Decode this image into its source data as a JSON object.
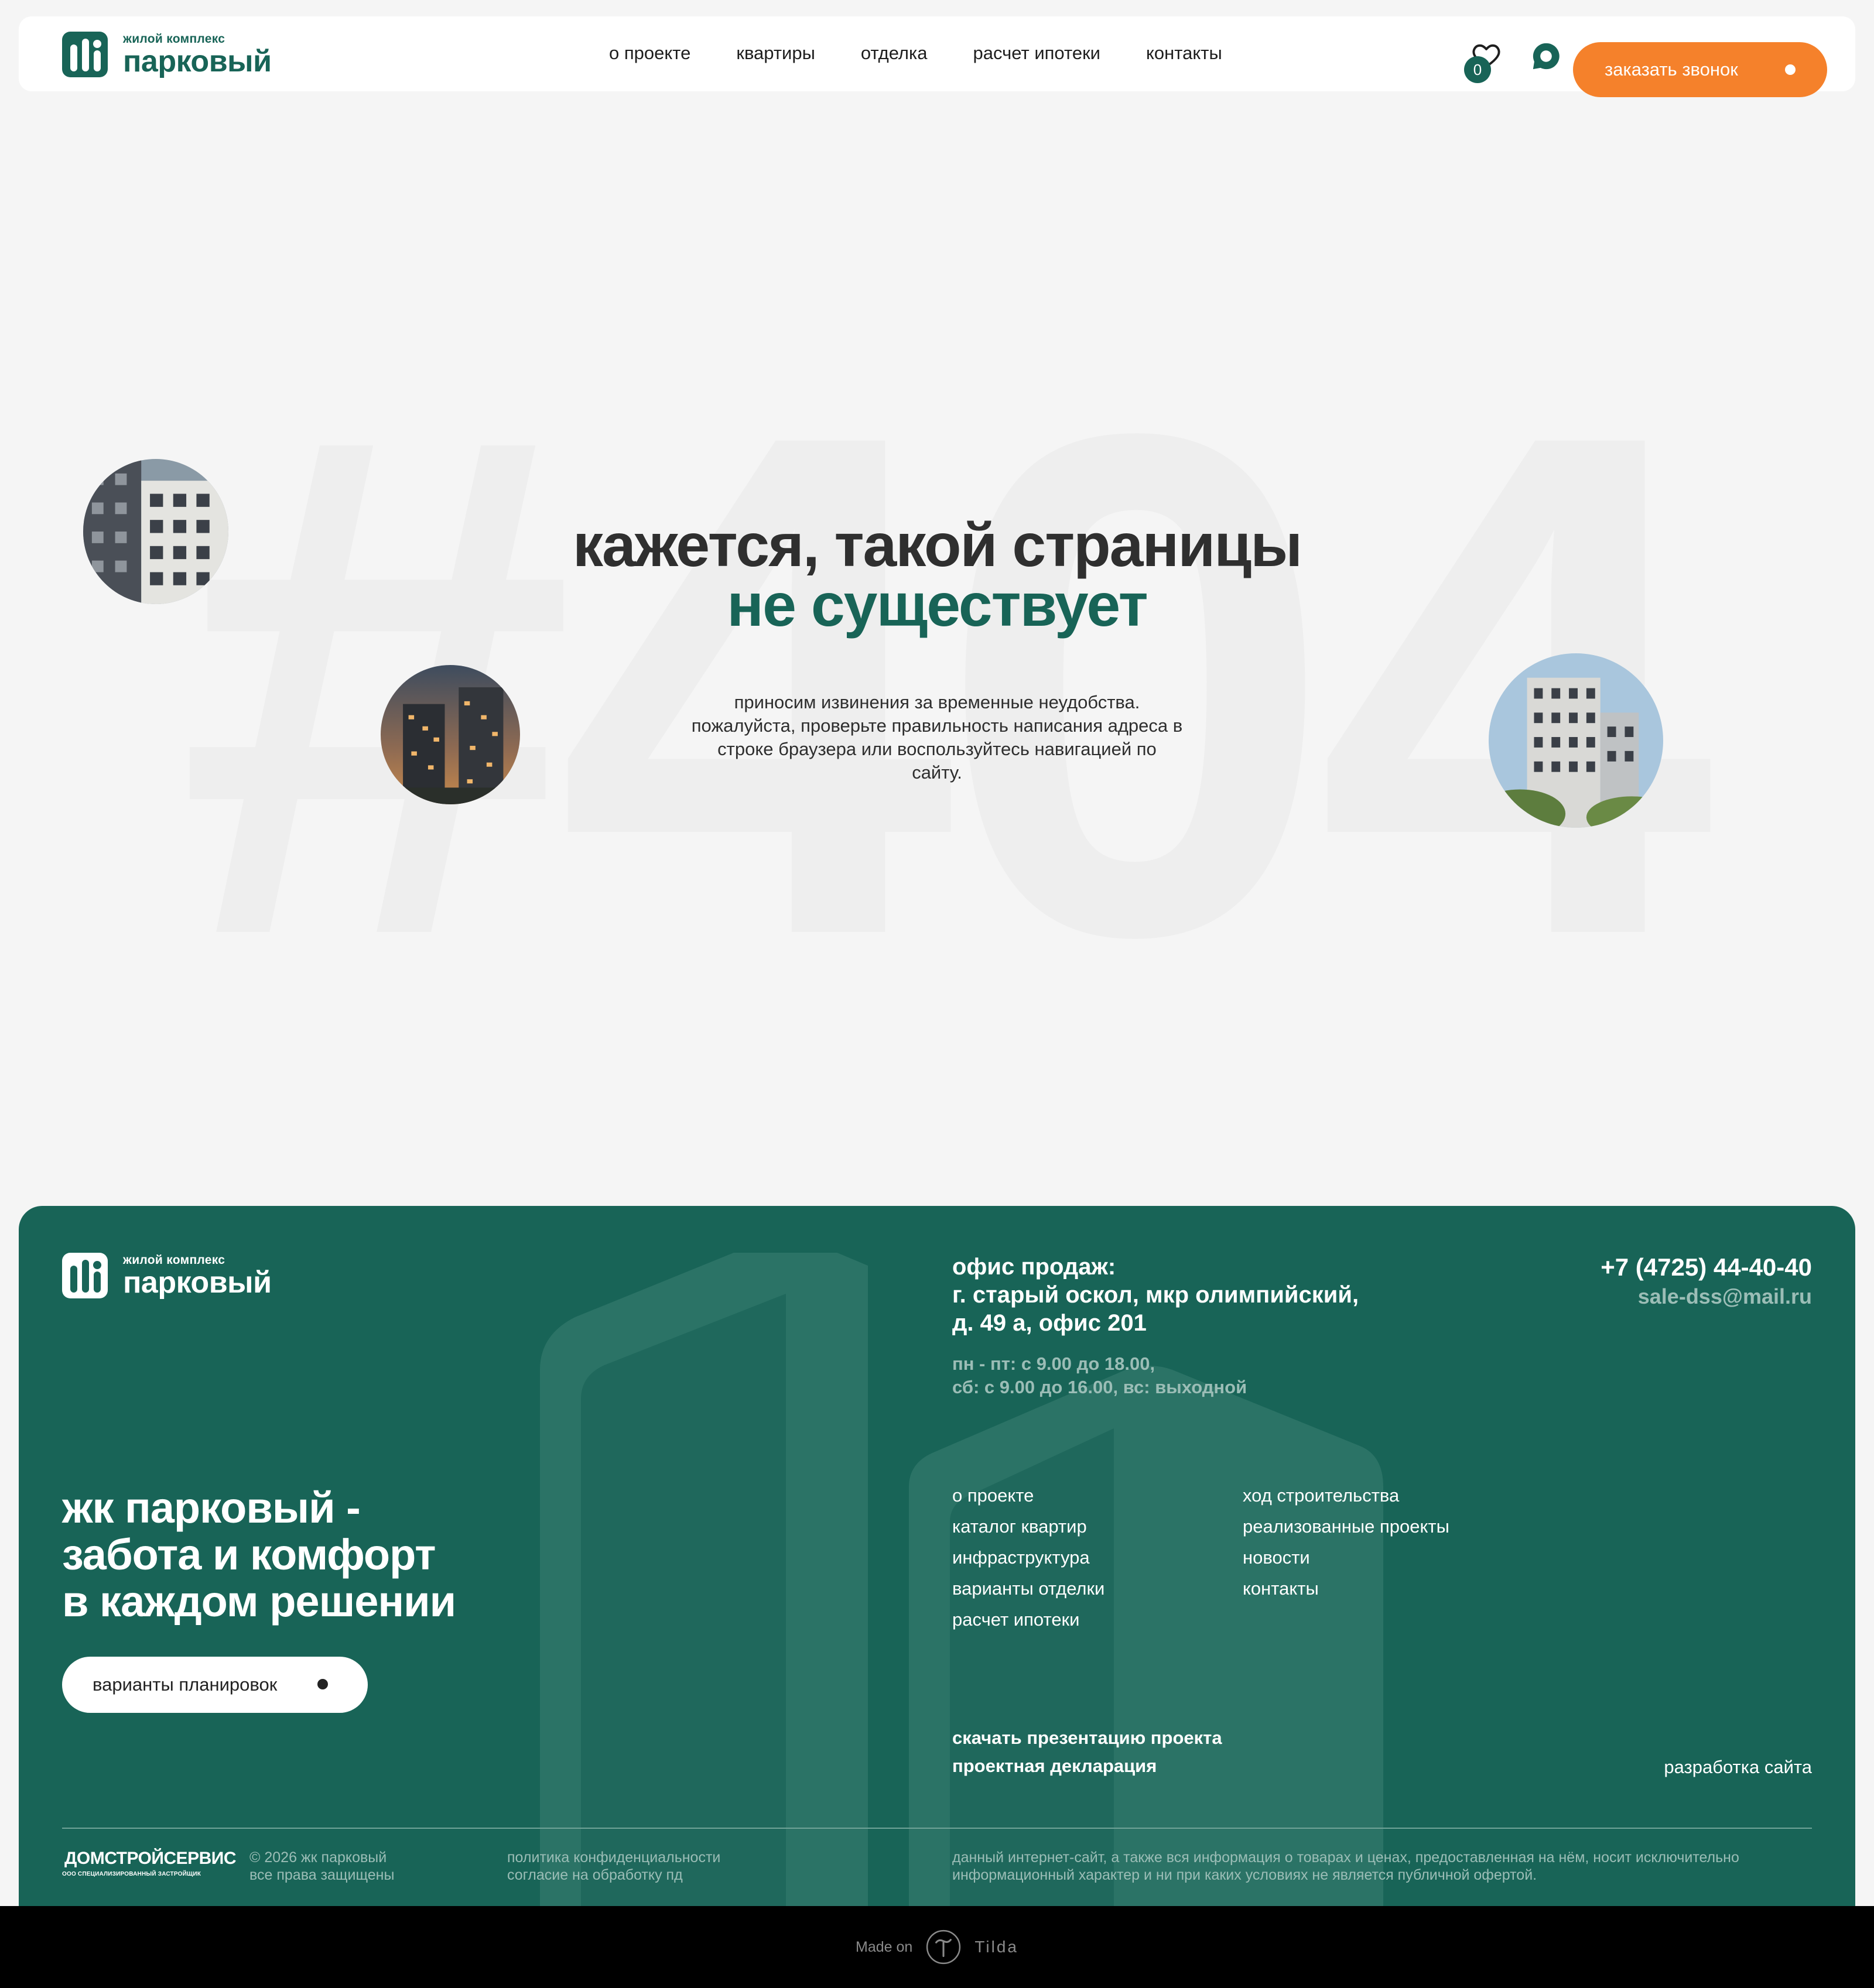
{
  "header": {
    "logo": {
      "small": "жилой комплекс",
      "big": "парковый"
    },
    "nav": [
      "о проекте",
      "квартиры",
      "отделка",
      "расчет ипотеки",
      "контакты"
    ],
    "favorites_count": "0",
    "cta_label": "заказать звонок"
  },
  "hero": {
    "bg_text": "#404",
    "title_line1": "кажется, такой страницы",
    "title_line2": "не существует",
    "text": "приносим извинения за временные неудобства. пожалуйста, проверьте правильность написания адреса в строке браузера или воспользуйтесь навигацией по сайту."
  },
  "footer": {
    "logo": {
      "small": "жилой комплекс",
      "big": "парковый"
    },
    "office": {
      "line1": "офис продаж:",
      "line2": "г. старый оскол, мкр олимпийский,",
      "line3": "д. 49 а, офис 201",
      "hours1": "пн - пт: с 9.00 до 18.00,",
      "hours2": "сб: с 9.00 до 16.00, вс: выходной"
    },
    "phone": "+7 (4725) 44-40-40",
    "email": "sale-dss@mail.ru",
    "slogan": [
      "жк парковый -",
      "забота и комфорт",
      "в каждом решении"
    ],
    "plans_button": "варианты планировок",
    "links_col1": [
      "о проекте",
      "каталог квартир",
      "инфраструктура",
      "варианты отделки",
      "расчет ипотеки"
    ],
    "links_col2": [
      "ход строительства",
      "реализованные проекты",
      "новости",
      "контакты"
    ],
    "docs": [
      "скачать презентацию проекта",
      "проектная декларация"
    ],
    "dev_link": "разработка сайта",
    "developer": {
      "name": "ДОМСТРОЙСЕРВИС",
      "sub": "ООО СПЕЦИАЛИЗИРОВАННЫЙ ЗАСТРОЙЩИК"
    },
    "copyright1": "© 2026 жк парковый",
    "copyright2": "все права защищены",
    "policy1": "политика конфиденциальности",
    "policy2": "согласие на обработку пд",
    "disclaimer": "данный интернет-сайт, а также вся информация о товарах и ценах, предоставленная на нём, носит исключительно информационный характер и ни при каких условиях не является публичной офертой."
  },
  "tilda": {
    "made_on": "Made on",
    "name": "Tilda"
  },
  "colors": {
    "brand_green": "#186457",
    "accent_orange": "#f5812b",
    "background": "#f5f5f5"
  },
  "icons": [
    "heart-icon",
    "chat-icon",
    "tilda-logo-icon"
  ]
}
